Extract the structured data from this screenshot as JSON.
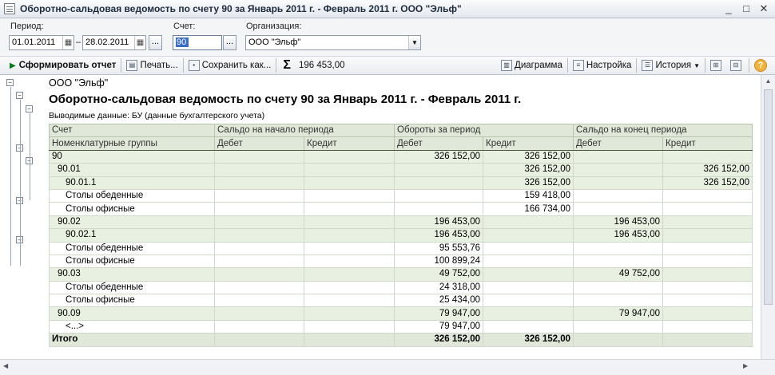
{
  "window": {
    "title": "Оборотно-сальдовая ведомость по счету 90 за Январь 2011 г. - Февраль 2011 г. ООО \"Эльф\"",
    "buttons": [
      "_",
      "□",
      "✕"
    ]
  },
  "filters": {
    "period_label": "Период:",
    "date_from": "01.01.2011",
    "date_sep": "–",
    "date_to": "28.02.2011",
    "period_btn": "...",
    "account_label": "Счет:",
    "account_value": "90",
    "account_btn": "...",
    "org_label": "Организация:",
    "org_value": "ООО \"Эльф\""
  },
  "toolbar": {
    "generate": "Сформировать отчет",
    "print": "Печать...",
    "save": "Сохранить как...",
    "sum": "196 453,00",
    "chart": "Диаграмма",
    "settings": "Настройка",
    "history": "История",
    "help": "?"
  },
  "report": {
    "org": "ООО \"Эльф\"",
    "title": "Оборотно-сальдовая ведомость по счету 90 за Январь 2011 г. - Февраль 2011 г.",
    "subtitle": "Выводимые данные:  БУ (данные бухгалтерского учета)",
    "headers1": [
      "Счет",
      "Сальдо на начало периода",
      "Обороты за период",
      "Сальдо на конец периода"
    ],
    "headers2": [
      "Номенклатурные группы",
      "Дебет",
      "Кредит",
      "Дебет",
      "Кредит",
      "Дебет",
      "Кредит"
    ],
    "rows": [
      {
        "name": "90",
        "indent": 0,
        "style": "g",
        "ob_d": "326 152,00",
        "ob_c": "326 152,00",
        "end_d": "",
        "end_c": ""
      },
      {
        "name": "90.01",
        "indent": 1,
        "style": "g",
        "ob_d": "",
        "ob_c": "326 152,00",
        "end_d": "",
        "end_c": "326 152,00"
      },
      {
        "name": "90.01.1",
        "indent": 2,
        "style": "g",
        "ob_d": "",
        "ob_c": "326 152,00",
        "end_d": "",
        "end_c": "326 152,00"
      },
      {
        "name": "Столы обеденные",
        "indent": 3,
        "style": "w",
        "ob_d": "",
        "ob_c": "159 418,00",
        "end_d": "",
        "end_c": ""
      },
      {
        "name": "Столы офисные",
        "indent": 3,
        "style": "w",
        "ob_d": "",
        "ob_c": "166 734,00",
        "end_d": "",
        "end_c": ""
      },
      {
        "name": "90.02",
        "indent": 1,
        "style": "g",
        "ob_d": "196 453,00",
        "ob_c": "",
        "end_d": "196 453,00",
        "end_c": ""
      },
      {
        "name": "90.02.1",
        "indent": 2,
        "style": "g",
        "ob_d": "196 453,00",
        "ob_c": "",
        "end_d": "196 453,00",
        "end_c": ""
      },
      {
        "name": "Столы обеденные",
        "indent": 3,
        "style": "w",
        "ob_d": "95 553,76",
        "ob_c": "",
        "end_d": "",
        "end_c": ""
      },
      {
        "name": "Столы офисные",
        "indent": 3,
        "style": "w",
        "ob_d": "100 899,24",
        "ob_c": "",
        "end_d": "",
        "end_c": ""
      },
      {
        "name": "90.03",
        "indent": 1,
        "style": "g",
        "ob_d": "49 752,00",
        "ob_c": "",
        "end_d": "49 752,00",
        "end_c": ""
      },
      {
        "name": "Столы обеденные",
        "indent": 2,
        "style": "w",
        "ob_d": "24 318,00",
        "ob_c": "",
        "end_d": "",
        "end_c": ""
      },
      {
        "name": "Столы офисные",
        "indent": 2,
        "style": "w",
        "ob_d": "25 434,00",
        "ob_c": "",
        "end_d": "",
        "end_c": ""
      },
      {
        "name": "90.09",
        "indent": 1,
        "style": "g",
        "ob_d": "79 947,00",
        "ob_c": "",
        "end_d": "79 947,00",
        "end_c": ""
      },
      {
        "name": "<...>",
        "indent": 2,
        "style": "w",
        "ob_d": "79 947,00",
        "ob_c": "",
        "end_d": "",
        "end_c": ""
      }
    ],
    "total": {
      "name": "Итого",
      "ob_d": "326 152,00",
      "ob_c": "326 152,00"
    }
  }
}
